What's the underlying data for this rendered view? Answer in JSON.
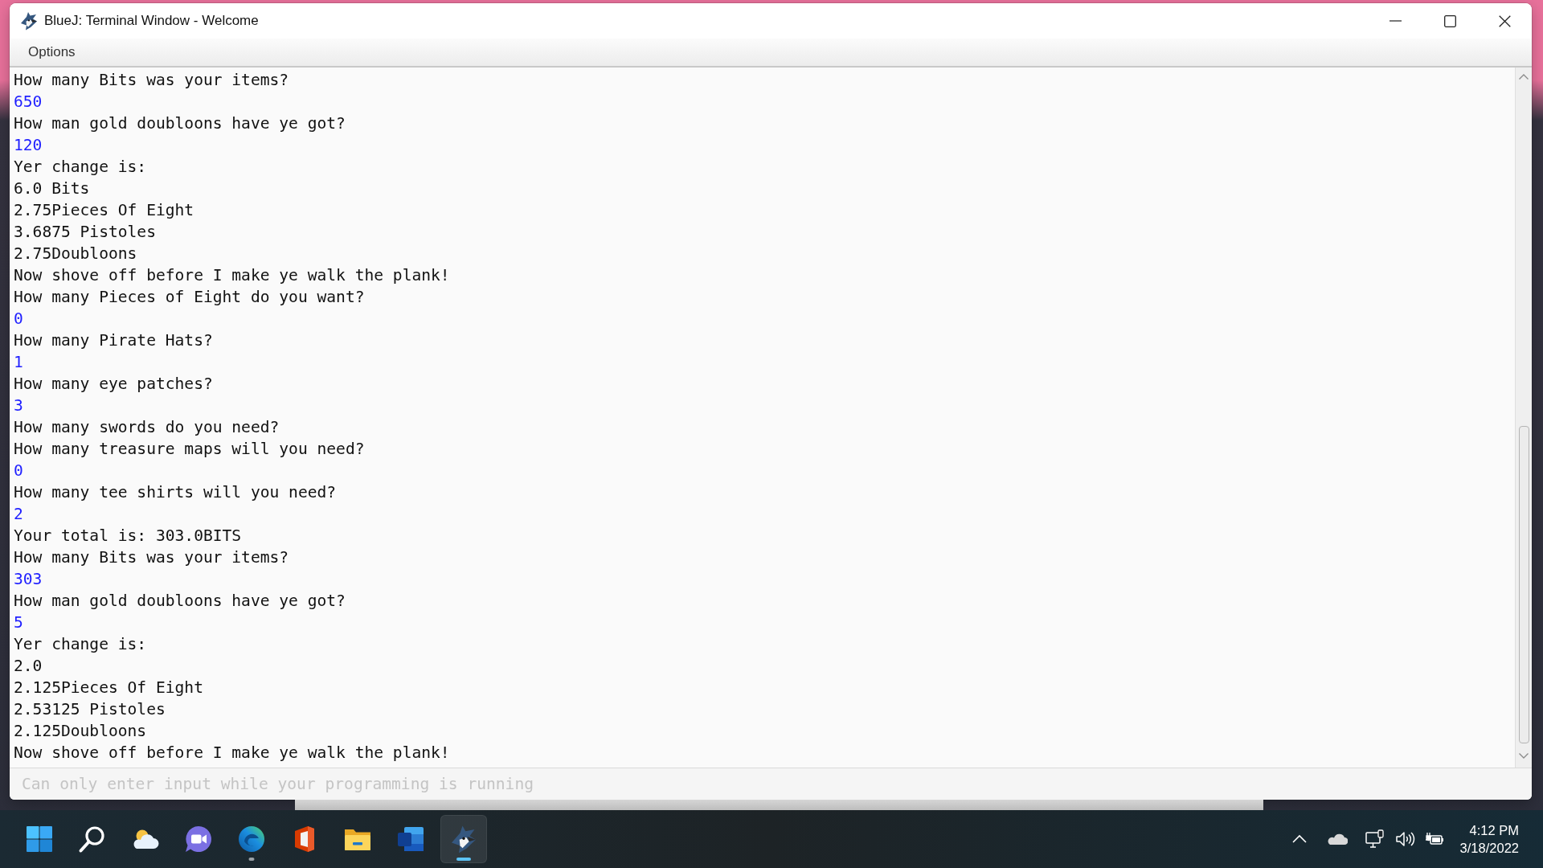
{
  "window": {
    "title": "BlueJ: Terminal Window - Welcome"
  },
  "menu": [
    "Options"
  ],
  "terminal": {
    "lines": [
      {
        "kind": "output",
        "text": "How many Bits was your items?"
      },
      {
        "kind": "input",
        "text": "650"
      },
      {
        "kind": "output",
        "text": "How man gold doubloons have ye got?"
      },
      {
        "kind": "input",
        "text": "120"
      },
      {
        "kind": "output",
        "text": "Yer change is:"
      },
      {
        "kind": "output",
        "text": "6.0 Bits"
      },
      {
        "kind": "output",
        "text": "2.75Pieces Of Eight"
      },
      {
        "kind": "output",
        "text": "3.6875 Pistoles"
      },
      {
        "kind": "output",
        "text": "2.75Doubloons"
      },
      {
        "kind": "output",
        "text": "Now shove off before I make ye walk the plank!"
      },
      {
        "kind": "output",
        "text": "How many Pieces of Eight do you want?"
      },
      {
        "kind": "input",
        "text": "0"
      },
      {
        "kind": "output",
        "text": "How many Pirate Hats?"
      },
      {
        "kind": "input",
        "text": "1"
      },
      {
        "kind": "output",
        "text": "How many eye patches?"
      },
      {
        "kind": "input",
        "text": "3"
      },
      {
        "kind": "output",
        "text": "How many swords do you need?"
      },
      {
        "kind": "output",
        "text": "How many treasure maps will you need?"
      },
      {
        "kind": "input",
        "text": "0"
      },
      {
        "kind": "output",
        "text": "How many tee shirts will you need?"
      },
      {
        "kind": "input",
        "text": "2"
      },
      {
        "kind": "output",
        "text": "Your total is: 303.0BITS"
      },
      {
        "kind": "output",
        "text": "How many Bits was your items?"
      },
      {
        "kind": "input",
        "text": "303"
      },
      {
        "kind": "output",
        "text": "How man gold doubloons have ye got?"
      },
      {
        "kind": "input",
        "text": "5"
      },
      {
        "kind": "output",
        "text": "Yer change is:"
      },
      {
        "kind": "output",
        "text": "2.0"
      },
      {
        "kind": "output",
        "text": "2.125Pieces Of Eight"
      },
      {
        "kind": "output",
        "text": "2.53125 Pistoles"
      },
      {
        "kind": "output",
        "text": "2.125Doubloons"
      },
      {
        "kind": "output",
        "text": "Now shove off before I make ye walk the plank!"
      }
    ]
  },
  "input": {
    "placeholder": "Can only enter input while your programming is running"
  },
  "taskbar": {
    "buttons": [
      {
        "selected": false,
        "running": false
      },
      {
        "selected": false,
        "running": false
      },
      {
        "selected": false,
        "running": false
      },
      {
        "selected": false,
        "running": false
      },
      {
        "selected": false,
        "running": true
      },
      {
        "selected": false,
        "running": false
      },
      {
        "selected": false,
        "running": false
      },
      {
        "selected": false,
        "running": false
      },
      {
        "selected": true,
        "running": true
      }
    ],
    "clock": {
      "time": "4:12 PM",
      "date": "3/18/2022"
    }
  }
}
